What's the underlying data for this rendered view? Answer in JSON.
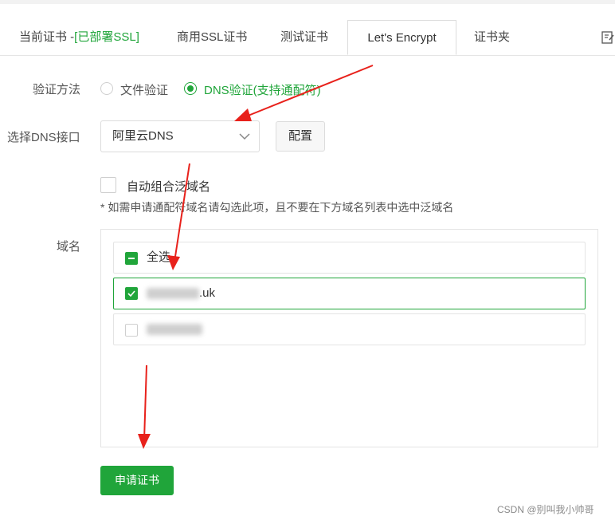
{
  "tabs": {
    "current_prefix": "当前证书 -",
    "current_status": "[已部署SSL]",
    "commercial": "商用SSL证书",
    "test": "测试证书",
    "letsencrypt": "Let's Encrypt",
    "certfolder": "证书夹"
  },
  "verify": {
    "label": "验证方法",
    "file_option": "文件验证",
    "dns_option": "DNS验证(支持通配符)",
    "selected": "dns"
  },
  "dns": {
    "label": "选择DNS接口",
    "value": "阿里云DNS",
    "config_button": "配置"
  },
  "wildcard": {
    "label": "自动组合泛域名",
    "checked": false
  },
  "hint": "* 如需申请通配符域名请勾选此项，且不要在下方域名列表中选中泛域名",
  "domains": {
    "label": "域名",
    "select_all": "全选",
    "items": [
      {
        "suffix": ".uk",
        "checked": true
      },
      {
        "suffix": "",
        "checked": false
      }
    ]
  },
  "apply_button": "申请证书",
  "watermark": "CSDN @别叫我小帅哥",
  "colors": {
    "accent": "#20a53a",
    "arrow": "#e8211b"
  }
}
